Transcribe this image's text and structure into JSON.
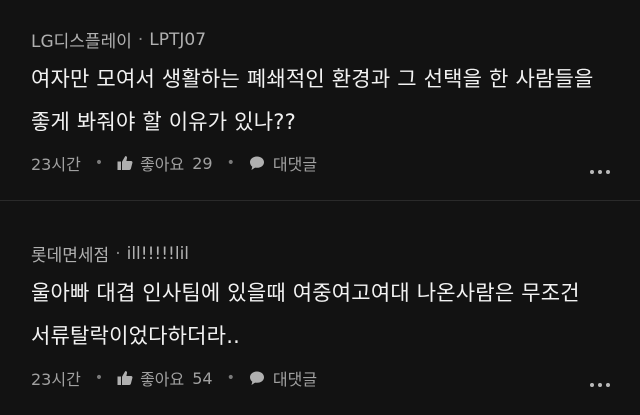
{
  "comments": [
    {
      "author": "LG디스플레이",
      "separator": "·",
      "handle": "LPTJ07",
      "lines": [
        "여자만 모여서 생활하는 폐쇄적인 환경과 그 선택을 한 사람들을",
        "좋게 봐줘야 할 이유가 있나??"
      ],
      "time": "23시간",
      "like_label": "좋아요",
      "like_count": "29",
      "reply_label": "대댓글"
    },
    {
      "author": "롯데면세점",
      "separator": "·",
      "handle": "ill!!!!!lil",
      "lines": [
        "울아빠 대겹 인사팀에 있을때 여중여고여대 나온사람은 무조건",
        "서류탈락이었다하더라.."
      ],
      "time": "23시간",
      "like_label": "좋아요",
      "like_count": "54",
      "reply_label": "대댓글"
    }
  ],
  "footer_separator": "•",
  "colors": {
    "background": "#121212",
    "text": "#f2f2f2",
    "meta": "#a7a7a7"
  },
  "icons": [
    "thumbs-up-icon",
    "speech-bubble-icon",
    "more-dots-icon"
  ]
}
